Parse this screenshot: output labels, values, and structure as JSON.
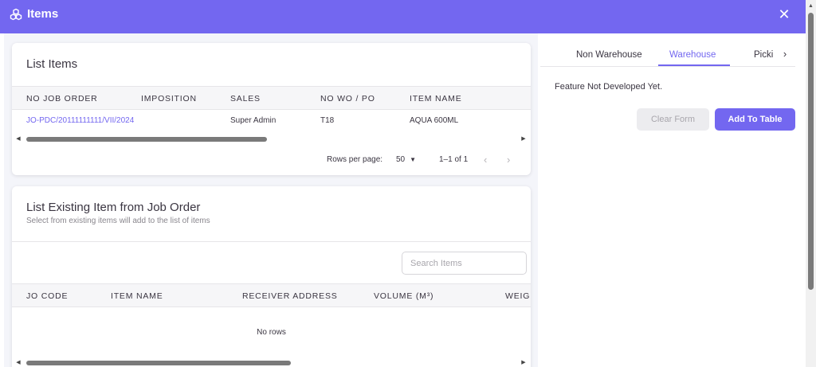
{
  "header": {
    "title": "Items"
  },
  "list_items": {
    "title": "List Items",
    "columns": [
      "NO JOB ORDER",
      "IMPOSITION",
      "SALES",
      "NO WO / PO",
      "ITEM NAME"
    ],
    "rows": [
      {
        "no_job_order": "JO-PDC/20111111111/VII/2024",
        "imposition": "",
        "sales": "Super Admin",
        "no_wo_po": "T18",
        "item_name": "AQUA 600ML"
      }
    ],
    "pagination": {
      "rows_per_page_label": "Rows per page:",
      "rows_per_page": "50",
      "range": "1–1 of 1"
    }
  },
  "existing_items": {
    "title": "List Existing Item from Job Order",
    "subtitle": "Select from existing items will add to the list of items",
    "search_placeholder": "Search Items",
    "columns": [
      "JO CODE",
      "ITEM NAME",
      "RECEIVER ADDRESS",
      "VOLUME (M³)",
      "WEIGH"
    ],
    "empty_text": "No rows"
  },
  "tabs": {
    "items": [
      "Non Warehouse",
      "Warehouse",
      "Picking"
    ],
    "active": "Warehouse"
  },
  "panel": {
    "message": "Feature Not Developed Yet.",
    "clear_label": "Clear Form",
    "add_label": "Add To Table"
  },
  "colors": {
    "primary": "#7367f0",
    "text": "#3a3541",
    "muted": "#a8a6ac"
  },
  "icons": {
    "app": "boxes-icon",
    "close": "close-icon",
    "tab_next": "chevron-right-icon"
  }
}
